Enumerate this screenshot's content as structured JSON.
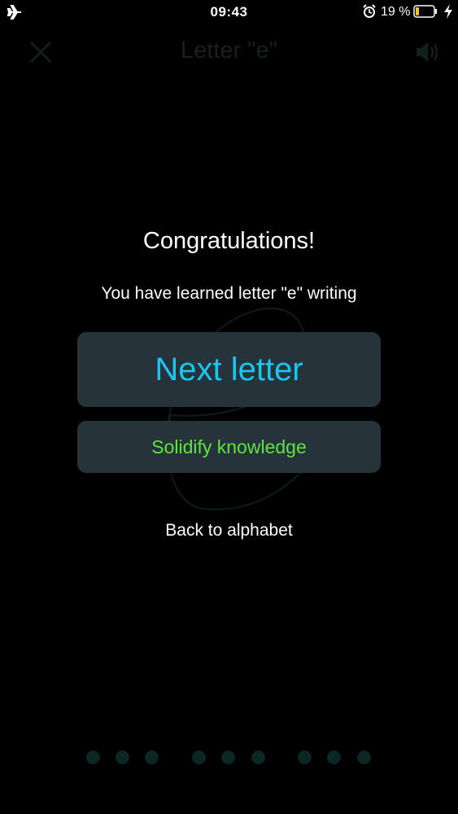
{
  "status_bar": {
    "time": "09:43",
    "battery_percent": "19 %",
    "battery_level": 0.19,
    "icons": [
      "airplane-icon",
      "alarm-icon",
      "battery-icon",
      "charging-icon"
    ]
  },
  "nav": {
    "title": "Letter \"e\"",
    "left_icon": "close-icon",
    "right_icon": "speaker-icon"
  },
  "dialog": {
    "title": "Congratulations!",
    "message": "You have learned letter \"e\" writing",
    "next_button_label": "Next letter",
    "solidify_button_label": "Solidify knowledge",
    "back_link_label": "Back to alphabet"
  },
  "colors": {
    "background": "#000000",
    "button_bg": "#26333a",
    "next_label": "#19c6ef",
    "solidify_label": "#5de53c",
    "dot": "#0b2623"
  },
  "page_dots": {
    "groups": 3,
    "per_group": 3
  }
}
